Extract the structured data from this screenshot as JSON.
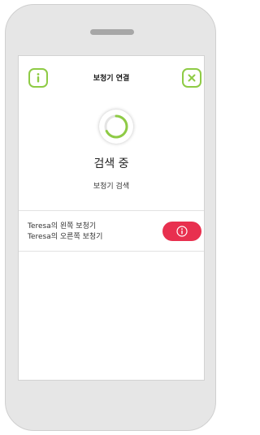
{
  "header": {
    "title": "보청기 연결",
    "info_icon": "info-icon",
    "close_icon": "close-icon"
  },
  "search": {
    "status_title": "검색 중",
    "status_subtitle": "보청기 검색"
  },
  "devices": [
    {
      "owner": "Teresa",
      "label": "의 왼쪽 보청기"
    },
    {
      "owner": "Teresa",
      "label": "의 오른쪽 보청기"
    }
  ],
  "alert_button": {
    "icon": "info-icon"
  },
  "colors": {
    "accent_green": "#8ecb45",
    "alert_red": "#e8304f"
  }
}
